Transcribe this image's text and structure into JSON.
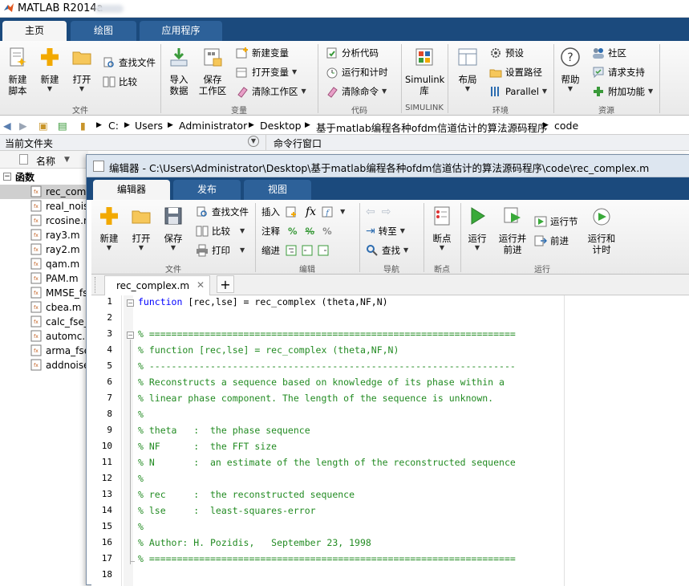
{
  "app_title": "MATLAB R2014a",
  "main_tabs": [
    {
      "label": "主页"
    },
    {
      "label": "绘图"
    },
    {
      "label": "应用程序"
    }
  ],
  "ribbon": {
    "file_group": {
      "label": "文件",
      "new_script": "新建\n脚本",
      "new": "新建",
      "open": "打开",
      "find_files": "查找文件",
      "compare": "比较"
    },
    "variable_group": {
      "label": "变量",
      "import": "导入\n数据",
      "save_ws": "保存\n工作区",
      "new_var": "新建变量",
      "open_var": "打开变量",
      "clear_ws": "清除工作区"
    },
    "code_group": {
      "label": "代码",
      "analyze": "分析代码",
      "run_time": "运行和计时",
      "clear_cmd": "清除命令"
    },
    "simulink_group": {
      "label": "SIMULINK",
      "library": "Simulink\n库"
    },
    "env_group": {
      "label": "环境",
      "layout": "布局",
      "prefs": "预设",
      "set_path": "设置路径",
      "parallel": "Parallel"
    },
    "resources_group": {
      "label": "资源",
      "help": "帮助",
      "community": "社区",
      "request_support": "请求支持",
      "addons": "附加功能"
    }
  },
  "address": {
    "crumbs": [
      "C:",
      "Users",
      "Administrator",
      "Desktop",
      "基于matlab编程各种ofdm信道估计的算法源码程序",
      "code"
    ]
  },
  "panels": {
    "current_folder": "当前文件夹",
    "command_window": "命令行窗口",
    "name_col": "名称",
    "group_label": "函数"
  },
  "files": [
    "rec_complex.m",
    "real_noise.m",
    "rcosine.m",
    "ray3.m",
    "ray2.m",
    "qam.m",
    "PAM.m",
    "MMSE_fse.m",
    "cbea.m",
    "calc_fse.m",
    "automc.m",
    "arma_fse.m",
    "addnoise.m"
  ],
  "file_display": [
    "rec_comp",
    "real_nois",
    "rcosine.n",
    "ray3.m",
    "ray2.m",
    "qam.m",
    "PAM.m",
    "MMSE_fs",
    "cbea.m",
    "calc_fse_",
    "automc.r",
    "arma_fse",
    "addnoise"
  ],
  "editor": {
    "title": "编辑器 - C:\\Users\\Administrator\\Desktop\\基于matlab编程各种ofdm信道估计的算法源码程序\\code\\rec_complex.m",
    "tabs": [
      {
        "label": "编辑器"
      },
      {
        "label": "发布"
      },
      {
        "label": "视图"
      }
    ],
    "ribbon": {
      "file": {
        "label": "文件",
        "new": "新建",
        "open": "打开",
        "save": "保存",
        "find_files": "查找文件",
        "compare": "比较",
        "print": "打印"
      },
      "edit": {
        "label": "编辑",
        "insert": "插入",
        "comment": "注释",
        "indent": "缩进"
      },
      "nav": {
        "label": "导航",
        "goto": "转至",
        "find": "查找"
      },
      "breakpoints": {
        "label": "断点",
        "breakpoints": "断点"
      },
      "run": {
        "label": "运行",
        "run": "运行",
        "run_advance": "运行并\n前进",
        "run_section": "运行节",
        "advance": "前进",
        "run_time": "运行和\n计时"
      }
    },
    "doc_tab": "rec_complex.m",
    "code_lines": [
      {
        "n": "1",
        "t": "function [rec,lse] = rec_complex (theta,NF,N)",
        "k": "fn"
      },
      {
        "n": "2",
        "t": "",
        "k": "blank"
      },
      {
        "n": "3",
        "t": "% ==================================================================",
        "k": "c"
      },
      {
        "n": "4",
        "t": "% function [rec,lse] = rec_complex (theta,NF,N)",
        "k": "c"
      },
      {
        "n": "5",
        "t": "% ------------------------------------------------------------------",
        "k": "c"
      },
      {
        "n": "6",
        "t": "% Reconstructs a sequence based on knowledge of its phase within a",
        "k": "c"
      },
      {
        "n": "7",
        "t": "% linear phase component. The length of the sequence is unknown.",
        "k": "c"
      },
      {
        "n": "8",
        "t": "%",
        "k": "c"
      },
      {
        "n": "9",
        "t": "% theta   :  the phase sequence",
        "k": "c"
      },
      {
        "n": "10",
        "t": "% NF      :  the FFT size",
        "k": "c"
      },
      {
        "n": "11",
        "t": "% N       :  an estimate of the length of the reconstructed sequence",
        "k": "c"
      },
      {
        "n": "12",
        "t": "%",
        "k": "c"
      },
      {
        "n": "13",
        "t": "% rec     :  the reconstructed sequence",
        "k": "c"
      },
      {
        "n": "14",
        "t": "% lse     :  least-squares-error",
        "k": "c"
      },
      {
        "n": "15",
        "t": "%",
        "k": "c"
      },
      {
        "n": "16",
        "t": "% Author: H. Pozidis,   September 23, 1998",
        "k": "c"
      },
      {
        "n": "17",
        "t": "% ==================================================================",
        "k": "c"
      },
      {
        "n": "18",
        "t": "",
        "k": "blank"
      }
    ]
  },
  "colors": {
    "ribbon_tab_bg": "#1b4a7d",
    "comment": "#228b22",
    "keyword": "#0000ff"
  }
}
